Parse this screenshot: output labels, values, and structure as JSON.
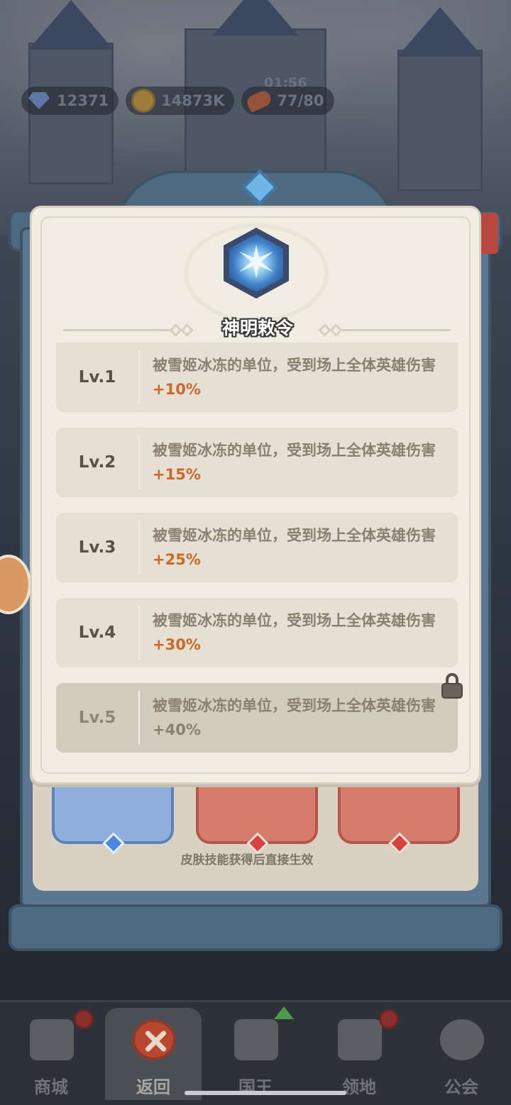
{
  "hud": {
    "gems": "12371",
    "gold": "14873K",
    "stamina": "77/80",
    "timer": "01:56"
  },
  "popup": {
    "title": "神明敕令",
    "icon": "snowflake-crystal-icon",
    "levels": [
      {
        "label": "Lv.1",
        "text": "被雪姬冰冻的单位，受到场上全体英雄伤害",
        "bonus": "+10%",
        "locked": false
      },
      {
        "label": "Lv.2",
        "text": "被雪姬冰冻的单位，受到场上全体英雄伤害",
        "bonus": "+15%",
        "locked": false
      },
      {
        "label": "Lv.3",
        "text": "被雪姬冰冻的单位，受到场上全体英雄伤害",
        "bonus": "+25%",
        "locked": false
      },
      {
        "label": "Lv.4",
        "text": "被雪姬冰冻的单位，受到场上全体英雄伤害",
        "bonus": "+30%",
        "locked": false
      },
      {
        "label": "Lv.5",
        "text": "被雪姬冰冻的单位，受到场上全体英雄伤害",
        "bonus": "+40%",
        "locked": true
      }
    ]
  },
  "hint": "皮肤技能获得后直接生效",
  "nav": {
    "items": [
      {
        "label": "商城",
        "icon": "shop-icon"
      },
      {
        "label": "返回",
        "icon": "close-icon"
      },
      {
        "label": "国王",
        "icon": "crown-icon"
      },
      {
        "label": "领地",
        "icon": "castle-icon"
      },
      {
        "label": "公会",
        "icon": "planet-icon"
      }
    ]
  },
  "colors": {
    "bonus": "#c9692a",
    "popup_bg": "#f2ede3",
    "row_bg": "#e5dfd4",
    "locked_row_bg": "#d2ccbf"
  }
}
